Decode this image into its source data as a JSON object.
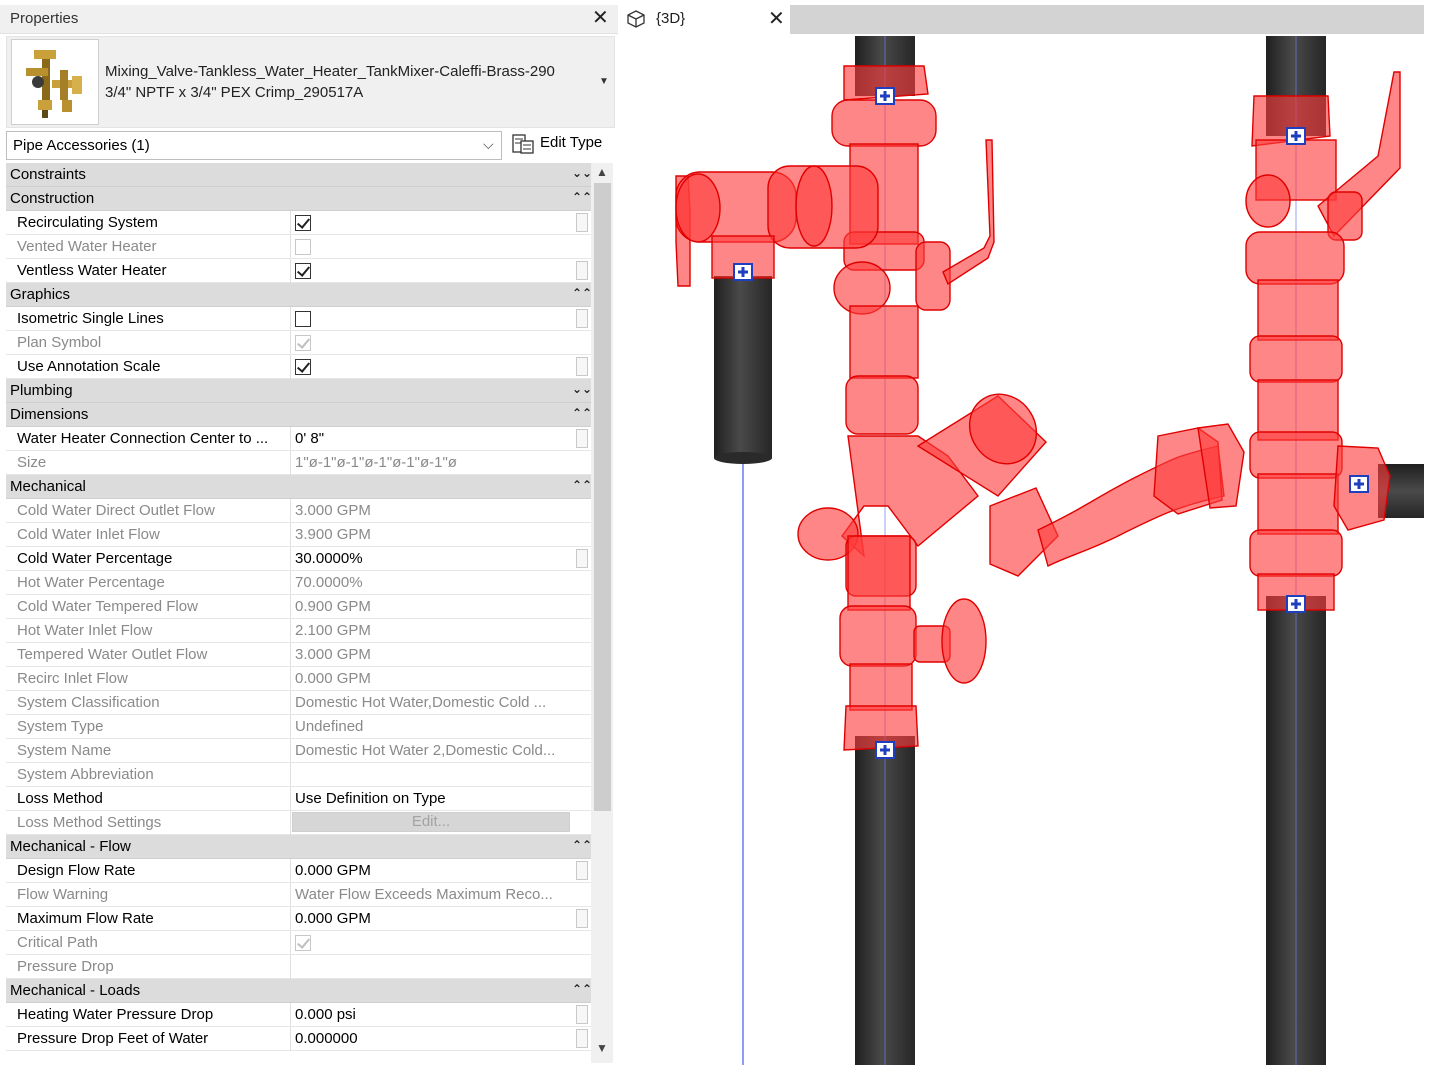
{
  "properties": {
    "title": "Properties",
    "close_glyph": "✕",
    "type_name_line1": "Mixing_Valve-Tankless_Water_Heater_TankMixer-Caleffi-Brass-290",
    "type_name_line2": "3/4\" NPTF x 3/4\" PEX Crimp_290517A",
    "instance_filter": "Pipe Accessories (1)",
    "edit_type_label": "Edit Type",
    "groups": {
      "constraints": "Constraints",
      "construction": "Construction",
      "graphics": "Graphics",
      "plumbing": "Plumbing",
      "dimensions": "Dimensions",
      "mechanical": "Mechanical",
      "mechanical_flow": "Mechanical - Flow",
      "mechanical_loads": "Mechanical - Loads"
    },
    "rows": {
      "recirculating_system": "Recirculating System",
      "vented_water_heater": "Vented Water Heater",
      "ventless_water_heater": "Ventless Water Heater",
      "isometric_single_lines": "Isometric Single Lines",
      "plan_symbol": "Plan Symbol",
      "use_annotation_scale": "Use Annotation Scale",
      "water_heater_conn_name": "Water Heater Connection Center to ...",
      "water_heater_conn_value": "0'  8\"",
      "size_name": "Size",
      "size_value": "1\"ø-1\"ø-1\"ø-1\"ø-1\"ø-1\"ø",
      "cwd_outlet_flow_name": "Cold Water Direct Outlet Flow",
      "cwd_outlet_flow_value": "3.000 GPM",
      "cw_inlet_flow_name": "Cold Water Inlet Flow",
      "cw_inlet_flow_value": "3.900 GPM",
      "cw_percentage_name": "Cold Water Percentage",
      "cw_percentage_value": "30.0000%",
      "hw_percentage_name": "Hot Water Percentage",
      "hw_percentage_value": "70.0000%",
      "cw_tempered_flow_name": "Cold Water Tempered Flow",
      "cw_tempered_flow_value": "0.900 GPM",
      "hw_inlet_flow_name": "Hot Water Inlet Flow",
      "hw_inlet_flow_value": "2.100 GPM",
      "tw_outlet_flow_name": "Tempered Water Outlet Flow",
      "tw_outlet_flow_value": "3.000 GPM",
      "recirc_inlet_flow_name": "Recirc Inlet Flow",
      "recirc_inlet_flow_value": "0.000 GPM",
      "system_classification_name": "System Classification",
      "system_classification_value": "Domestic Hot Water,Domestic Cold ...",
      "system_type_name": "System Type",
      "system_type_value": "Undefined",
      "system_name_name": "System Name",
      "system_name_value": "Domestic Hot Water 2,Domestic Cold...",
      "system_abbreviation_name": "System Abbreviation",
      "loss_method_name": "Loss Method",
      "loss_method_value": "Use Definition on Type",
      "loss_method_settings_name": "Loss Method Settings",
      "loss_method_settings_button": "Edit...",
      "design_flow_rate_name": "Design Flow Rate",
      "design_flow_rate_value": "0.000 GPM",
      "flow_warning_name": "Flow Warning",
      "flow_warning_value": "Water Flow Exceeds Maximum Reco...",
      "max_flow_rate_name": "Maximum Flow Rate",
      "max_flow_rate_value": "0.000 GPM",
      "critical_path_name": "Critical Path",
      "pressure_drop_name": "Pressure Drop",
      "heating_water_pd_name": "Heating Water Pressure Drop",
      "heating_water_pd_value": "0.000 psi",
      "pd_feet_water_name": "Pressure Drop Feet of Water",
      "pd_feet_water_value": "0.000000"
    },
    "checkboxes": {
      "recirculating_system": true,
      "vented_water_heater": false,
      "ventless_water_heater": true,
      "isometric_single_lines": false,
      "plan_symbol": true,
      "use_annotation_scale": true,
      "critical_path": true
    }
  },
  "view": {
    "tab_label": "{3D}",
    "close_glyph": "✕",
    "icon": "3d-view-cube-icon"
  },
  "colors": {
    "selection_red": "#ff3b3b",
    "pipe_dark": "#3a3a3a",
    "connector_blue": "#1e3fbf"
  }
}
